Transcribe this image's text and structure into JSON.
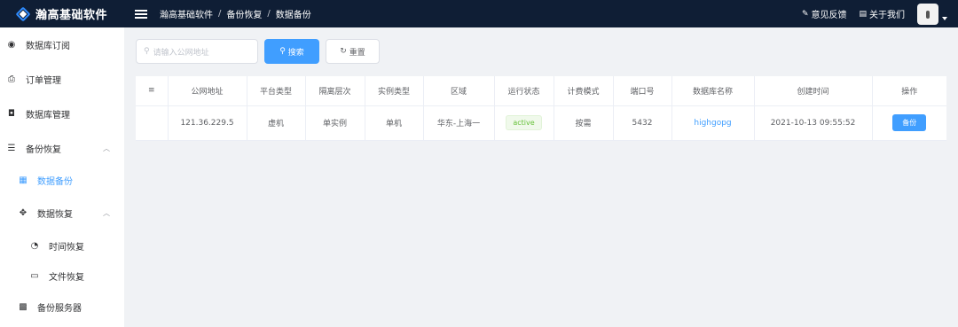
{
  "app": {
    "title": "瀚高基础软件",
    "breadcrumb": [
      "瀚高基础软件",
      "备份恢复",
      "数据备份"
    ],
    "breadcrumb_sep": "/"
  },
  "topbar": {
    "feedback": "意见反馈",
    "about": "关于我们"
  },
  "sidebar": {
    "items": [
      {
        "label": "数据库订阅",
        "icon": "dashboard-icon"
      },
      {
        "label": "订单管理",
        "icon": "order-icon"
      },
      {
        "label": "数据库管理",
        "icon": "database-icon"
      },
      {
        "label": "备份恢复",
        "icon": "backup-icon",
        "expanded": true
      },
      {
        "label": "数据备份",
        "icon": "grid-icon",
        "active": true
      },
      {
        "label": "数据恢复",
        "icon": "move-icon",
        "expanded": true
      },
      {
        "label": "时间恢复",
        "icon": "clock-icon"
      },
      {
        "label": "文件恢复",
        "icon": "file-icon"
      },
      {
        "label": "备份服务器",
        "icon": "server-icon"
      }
    ]
  },
  "search": {
    "placeholder": "请输入公网地址",
    "search_button": "搜索",
    "reset_button": "重置"
  },
  "table": {
    "columns": [
      "",
      "公网地址",
      "平台类型",
      "隔离层次",
      "实例类型",
      "区域",
      "运行状态",
      "计费模式",
      "端口号",
      "数据库名称",
      "创建时间",
      "操作"
    ],
    "rows": [
      {
        "ip": "121.36.229.5",
        "platform": "虚机",
        "isolation": "单实例",
        "instance_type": "单机",
        "region": "华东-上海一",
        "status": "active",
        "billing": "按需",
        "port": "5432",
        "db_name": "highgopg",
        "created": "2021-10-13 09:55:52",
        "action": "备份"
      }
    ]
  },
  "colors": {
    "topbar": "#0f1e35",
    "accent": "#409eff",
    "success": "#67c23a"
  }
}
